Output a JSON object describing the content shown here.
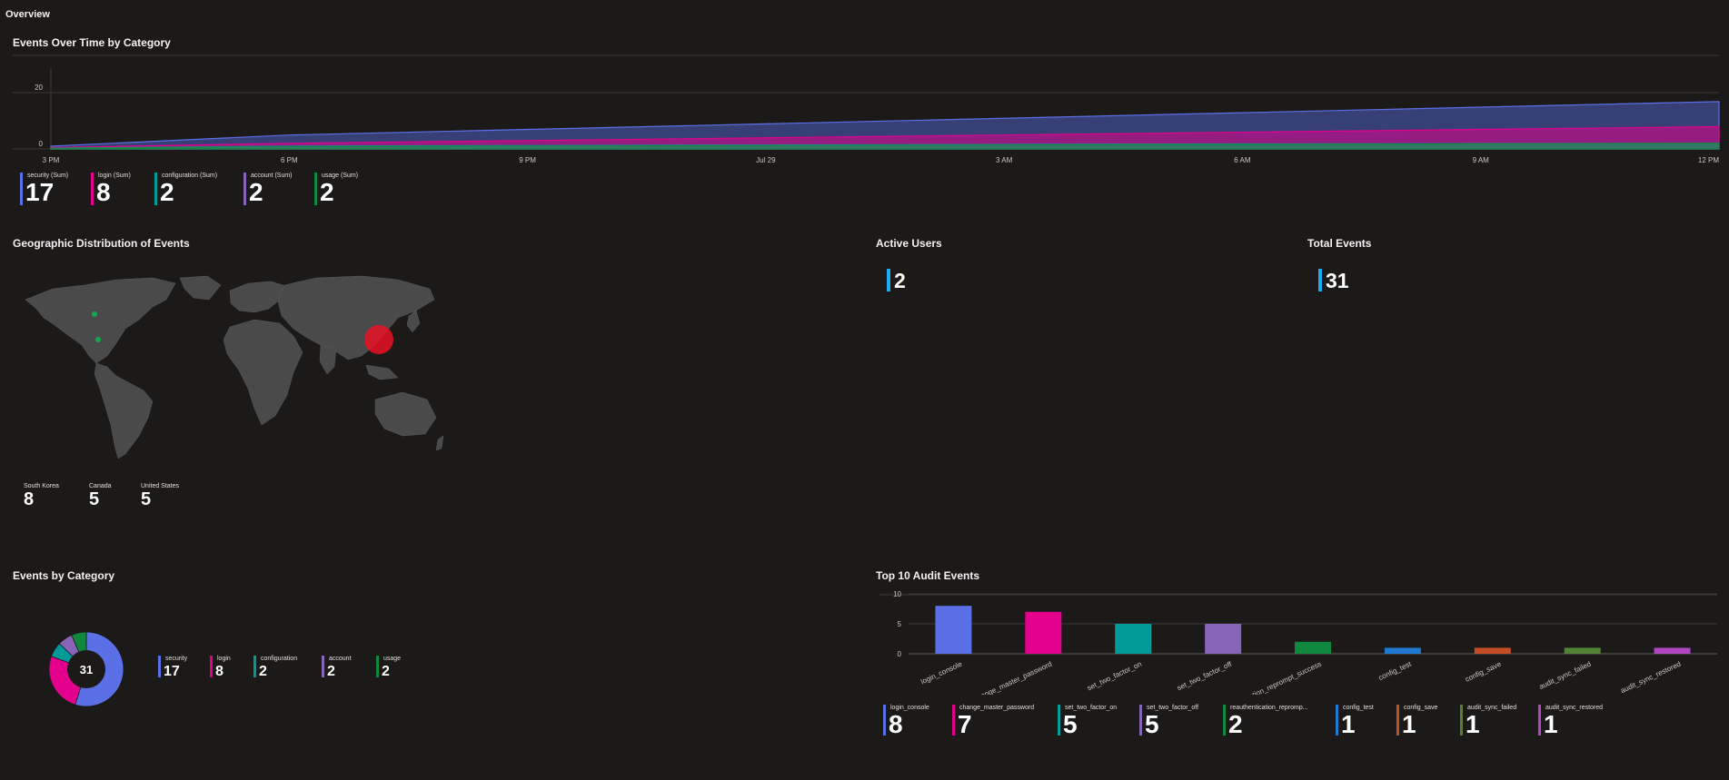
{
  "header": {
    "title": "Overview"
  },
  "timeline": {
    "title": "Events Over Time by Category",
    "legend": [
      {
        "name": "security (Sum)",
        "value": "17",
        "color": "#5b6fe6"
      },
      {
        "name": "login (Sum)",
        "value": "8",
        "color": "#e3008c"
      },
      {
        "name": "configuration (Sum)",
        "value": "2",
        "color": "#009a98"
      },
      {
        "name": "account (Sum)",
        "value": "2",
        "color": "#8764b8"
      },
      {
        "name": "usage (Sum)",
        "value": "2",
        "color": "#10893e"
      }
    ]
  },
  "geo": {
    "title": "Geographic Distribution of Events",
    "countries": [
      {
        "name": "South Korea",
        "value": "8"
      },
      {
        "name": "Canada",
        "value": "5"
      },
      {
        "name": "United States",
        "value": "5"
      }
    ]
  },
  "active_users": {
    "title": "Active Users",
    "value": "2"
  },
  "total_events": {
    "title": "Total Events",
    "value": "31"
  },
  "category": {
    "title": "Events by Category",
    "total": "31",
    "legend": [
      {
        "name": "security",
        "value": "17",
        "color": "#5b6fe6"
      },
      {
        "name": "login",
        "value": "8",
        "color": "#e3008c"
      },
      {
        "name": "configuration",
        "value": "2",
        "color": "#009a98"
      },
      {
        "name": "account",
        "value": "2",
        "color": "#8764b8"
      },
      {
        "name": "usage",
        "value": "2",
        "color": "#10893e"
      }
    ]
  },
  "audit": {
    "title": "Top 10 Audit Events",
    "legend": [
      {
        "name": "login_console",
        "value": "8",
        "color": "#5b6fe6"
      },
      {
        "name": "change_master_password",
        "value": "7",
        "color": "#e3008c"
      },
      {
        "name": "set_two_factor_on",
        "value": "5",
        "color": "#009a98"
      },
      {
        "name": "set_two_factor_off",
        "value": "5",
        "color": "#8764b8"
      },
      {
        "name": "reauthentication_repromp...",
        "value": "2",
        "color": "#10893e"
      },
      {
        "name": "config_test",
        "value": "1",
        "color": "#1f78d1"
      },
      {
        "name": "config_save",
        "value": "1",
        "color": "#c54d26"
      },
      {
        "name": "audit_sync_failed",
        "value": "1",
        "color": "#548235"
      },
      {
        "name": "audit_sync_restored",
        "value": "1",
        "color": "#b146c2"
      }
    ]
  },
  "chart_data": [
    {
      "type": "area",
      "x": [
        "3 PM",
        "6 PM",
        "9 PM",
        "Jul 29",
        "3 AM",
        "6 AM",
        "9 AM",
        "12 PM"
      ],
      "ylim": [
        0,
        30
      ],
      "y_ticks": [
        "0",
        "20"
      ],
      "series": [
        {
          "name": "security (Sum)",
          "color": "#5b6fe6",
          "values": [
            1,
            5,
            7,
            9,
            11,
            13,
            15,
            17
          ]
        },
        {
          "name": "login (Sum)",
          "color": "#e3008c",
          "values": [
            0.5,
            2,
            3,
            4,
            5,
            6,
            7,
            8
          ]
        },
        {
          "name": "configuration (Sum)",
          "color": "#009a98",
          "values": [
            0.3,
            1,
            1.2,
            1.4,
            1.6,
            1.8,
            1.9,
            2
          ]
        },
        {
          "name": "account (Sum)",
          "color": "#8764b8",
          "values": [
            0.2,
            0.8,
            1,
            1.2,
            1.4,
            1.6,
            1.8,
            2
          ]
        },
        {
          "name": "usage (Sum)",
          "color": "#10893e",
          "values": [
            0.2,
            0.8,
            1,
            1.2,
            1.4,
            1.6,
            1.8,
            2
          ]
        }
      ]
    },
    {
      "type": "pie",
      "categories": [
        "security",
        "login",
        "configuration",
        "account",
        "usage"
      ],
      "values": [
        17,
        8,
        2,
        2,
        2
      ],
      "colors": [
        "#5b6fe6",
        "#e3008c",
        "#009a98",
        "#8764b8",
        "#10893e"
      ],
      "center_label": "31"
    },
    {
      "type": "bar",
      "categories": [
        "login_console",
        "change_master_password",
        "set_two_factor_on",
        "set_two_factor_off",
        "reauthentication_reprompt_success",
        "config_test",
        "config_save",
        "audit_sync_failed",
        "audit_sync_restored"
      ],
      "values": [
        8,
        7,
        5,
        5,
        2,
        1,
        1,
        1,
        1
      ],
      "colors": [
        "#5b6fe6",
        "#e3008c",
        "#009a98",
        "#8764b8",
        "#10893e",
        "#1f78d1",
        "#c54d26",
        "#548235",
        "#b146c2"
      ],
      "ylim": [
        0,
        10
      ],
      "y_ticks": [
        "0",
        "5",
        "10"
      ]
    }
  ]
}
